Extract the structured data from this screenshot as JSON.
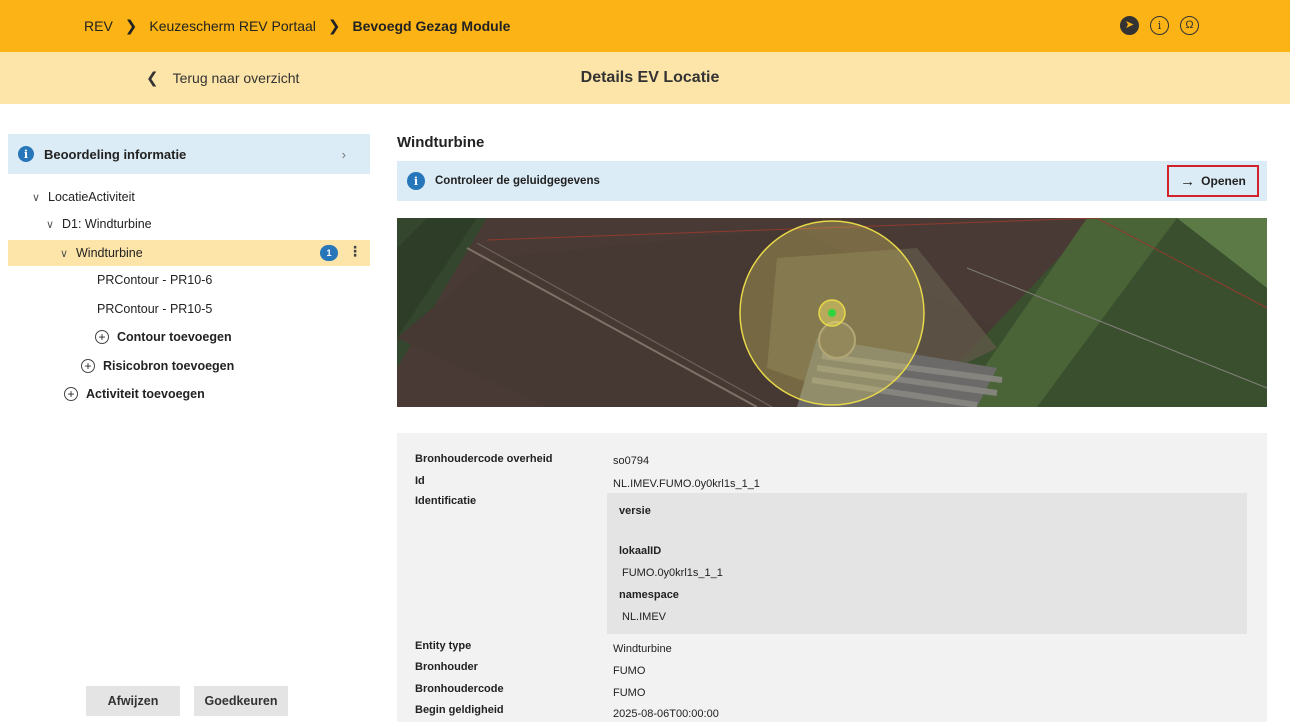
{
  "breadcrumb": {
    "items": [
      "REV",
      "Keuzescherm REV Portaal",
      "Bevoegd Gezag Module"
    ]
  },
  "top_icons": [
    "cursor-icon",
    "info-icon",
    "help-lifebuoy-icon"
  ],
  "subheader": {
    "back_label": "Terug naar overzicht",
    "title": "Details EV Locatie"
  },
  "sidebar": {
    "beoordeling_label": "Beoordeling informatie",
    "tree": {
      "locatie_activiteit": "LocatieActiviteit",
      "d1": "D1: Windturbine",
      "windturbine": "Windturbine",
      "windturbine_badge": "1",
      "pr1": "PRContour - PR10-6",
      "pr2": "PRContour - PR10-5",
      "add_contour": "Contour toevoegen",
      "add_risicobron": "Risicobron toevoegen",
      "add_activiteit": "Activiteit toevoegen"
    },
    "reject_label": "Afwijzen",
    "approve_label": "Goedkeuren"
  },
  "main": {
    "title": "Windturbine",
    "notice": "Controleer de geluidgegevens",
    "open_label": "Openen",
    "details": {
      "bronhoudercode_overheid_label": "Bronhoudercode overheid",
      "bronhoudercode_overheid_value": "so0794",
      "id_label": "Id",
      "id_value": "NL.IMEV.FUMO.0y0krl1s_1_1",
      "identificatie_label": "Identificatie",
      "versie_label": "versie",
      "lokaalid_label": "lokaalID",
      "lokaalid_value": "FUMO.0y0krl1s_1_1",
      "namespace_label": "namespace",
      "namespace_value": "NL.IMEV",
      "entity_type_label": "Entity type",
      "entity_type_value": "Windturbine",
      "bronhouder_label": "Bronhouder",
      "bronhouder_value": "FUMO",
      "bronhoudercode_label": "Bronhoudercode",
      "bronhoudercode_value": "FUMO",
      "begin_label": "Begin geldigheid",
      "begin_value": "2025-08-06T00:00:00"
    }
  },
  "colors": {
    "header": "#fbb315",
    "subheader": "#fde5a9",
    "info_blue": "#2776b9",
    "notice_bg": "#dcecf6",
    "highlight_red": "#d1212a"
  }
}
